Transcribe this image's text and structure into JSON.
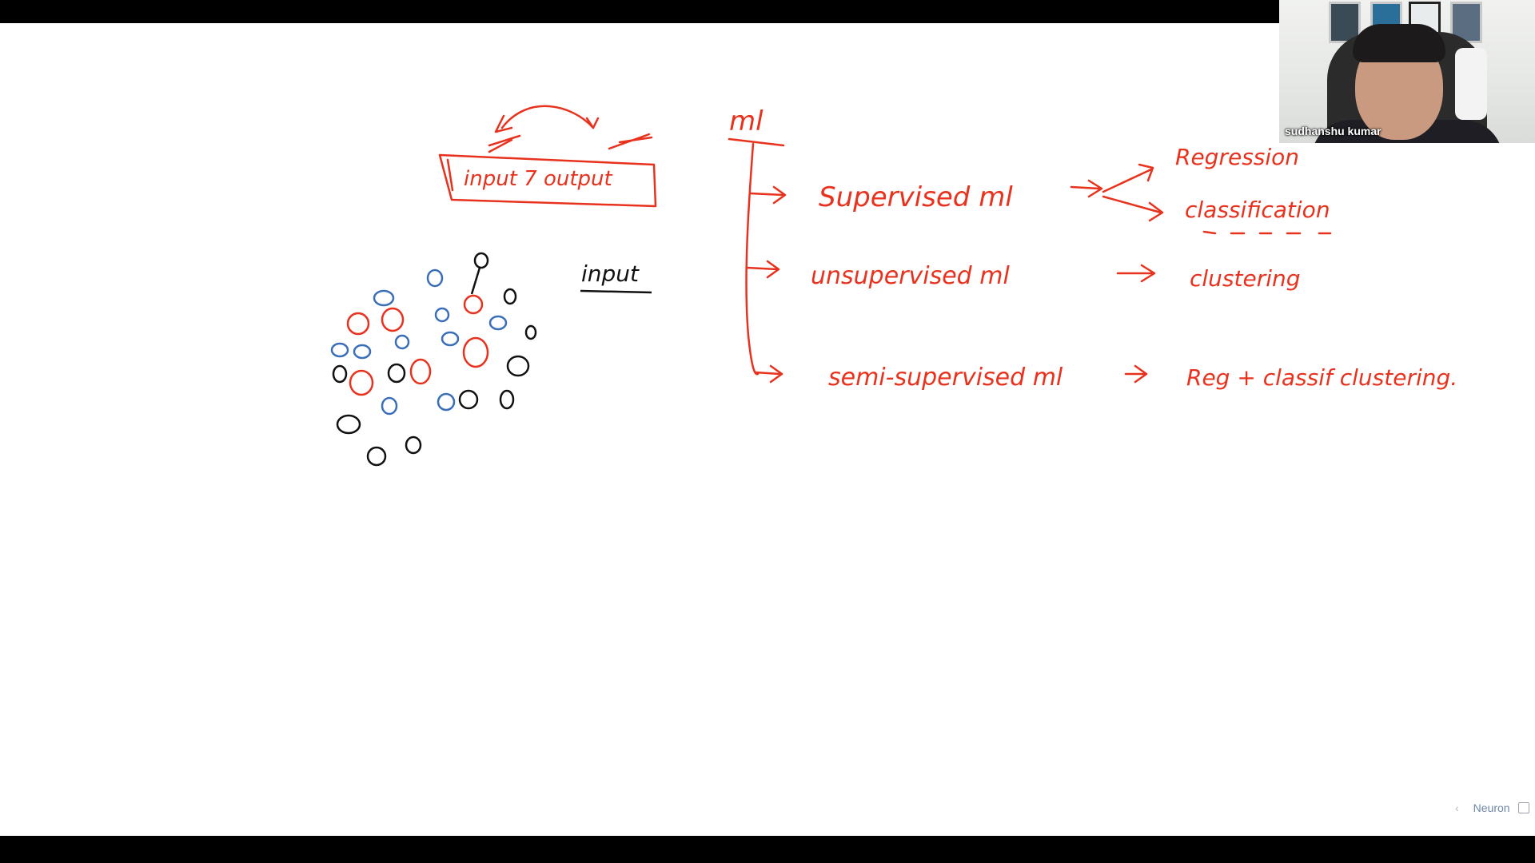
{
  "board": {
    "title_box": {
      "text": "input  7 output"
    },
    "input_label": "input",
    "ml_heading": "ml",
    "branches": [
      {
        "label": "Supervised  ml",
        "targets": [
          "Regression",
          "classification"
        ]
      },
      {
        "label": "unsupervised  ml",
        "targets": [
          "clustering"
        ]
      },
      {
        "label": "semi-supervised ml",
        "targets": [
          "Reg + classif  clustering."
        ]
      }
    ]
  },
  "webcam": {
    "presenter_name": "sudhanshu kumar"
  },
  "branding": {
    "logo_text": "Neuron",
    "prev_glyph": "‹"
  },
  "colors": {
    "ink_red": "#e8321e",
    "ink_blue": "#3a6fb8",
    "ink_black": "#111111",
    "board_bg": "#ffffff"
  }
}
